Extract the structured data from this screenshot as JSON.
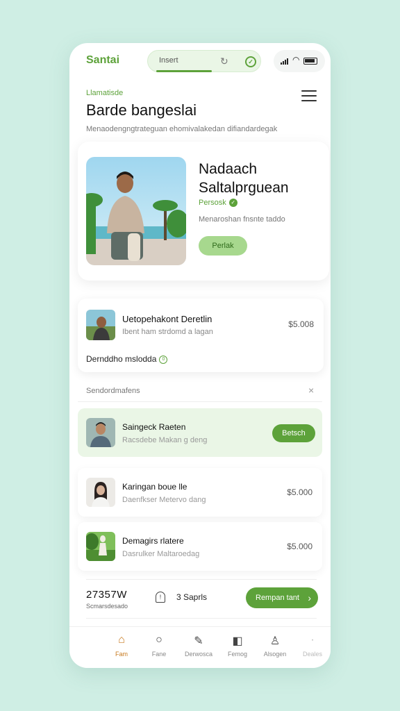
{
  "app": {
    "brand": "Santai",
    "search_value": "Insert",
    "eyebrow": "Llamatisde",
    "title": "Barde bangeslai",
    "subtitle": "Menaodengngtrateguan ehomivalakedan difiandardegak"
  },
  "profile": {
    "name": "Nadaach Saltalprguean",
    "verified_label": "Persosk",
    "description": "Menaroshan fnsnte taddo",
    "button_label": "Perlak"
  },
  "info_card": {
    "title": "Uetopehakont Deretlin",
    "subtitle": "Ibent ham strdomd a lagan",
    "price": "$5.008",
    "footer": "Dernddho mslodda"
  },
  "section": {
    "title": "Sendordmafens"
  },
  "rows": [
    {
      "title": "Saingeck Raeten",
      "subtitle": "Racsdebe Makan g deng",
      "action_label": "Betsch"
    },
    {
      "title": "Karingan boue lle",
      "subtitle": "Daenfkser Metervo dang",
      "price": "$5.000"
    },
    {
      "title": "Demagirs rlatere",
      "subtitle": "Dasrulker Maltaroedag",
      "price": "$5.000"
    }
  ],
  "summary": {
    "total": "27357W",
    "total_sub": "Scmarsdesado",
    "count_text": "3 Saprls",
    "cta_label": "Rempan tant"
  },
  "tabs": [
    {
      "label": "Fam",
      "icon": "home-icon"
    },
    {
      "label": "Fane",
      "icon": "search-icon"
    },
    {
      "label": "Derwosca",
      "icon": "edit-icon"
    },
    {
      "label": "Femog",
      "icon": "bag-icon"
    },
    {
      "label": "Alsogen",
      "icon": "user-icon"
    },
    {
      "label": "Deales",
      "icon": "more-icon"
    }
  ],
  "colors": {
    "accent": "#5da23a",
    "background": "#cfeee4",
    "active_tab": "#c77a1f"
  }
}
